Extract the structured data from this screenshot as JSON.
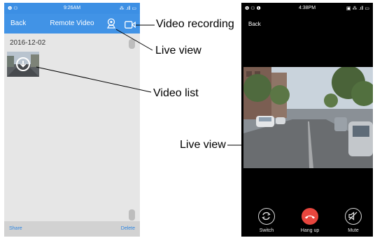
{
  "left_screen": {
    "status_bar": {
      "left": "❶ ⚇",
      "time": "9:26AM",
      "right": "⁂ .ıll ▭"
    },
    "header": {
      "back_label": "Back",
      "title": "Remote Video"
    },
    "date_label": "2016-12-02",
    "footer": {
      "share_label": "Share",
      "delete_label": "Delete"
    }
  },
  "annotations": {
    "video_recording": "Video recording",
    "live_view_top": "Live view",
    "video_list": "Video list",
    "live_view_right": "Live view"
  },
  "right_screen": {
    "status_bar": {
      "left": "❶ ⚇ ❶",
      "time": "4:38PM",
      "right": "▣ ⁂ .ıll ▭"
    },
    "back_label": "Back",
    "controls": {
      "switch_label": "Switch",
      "hangup_label": "Hang up",
      "mute_label": "Mute"
    }
  },
  "colors": {
    "header_blue": "#4193e6",
    "hangup_red": "#e8463e",
    "link_blue": "#2f86e0"
  }
}
